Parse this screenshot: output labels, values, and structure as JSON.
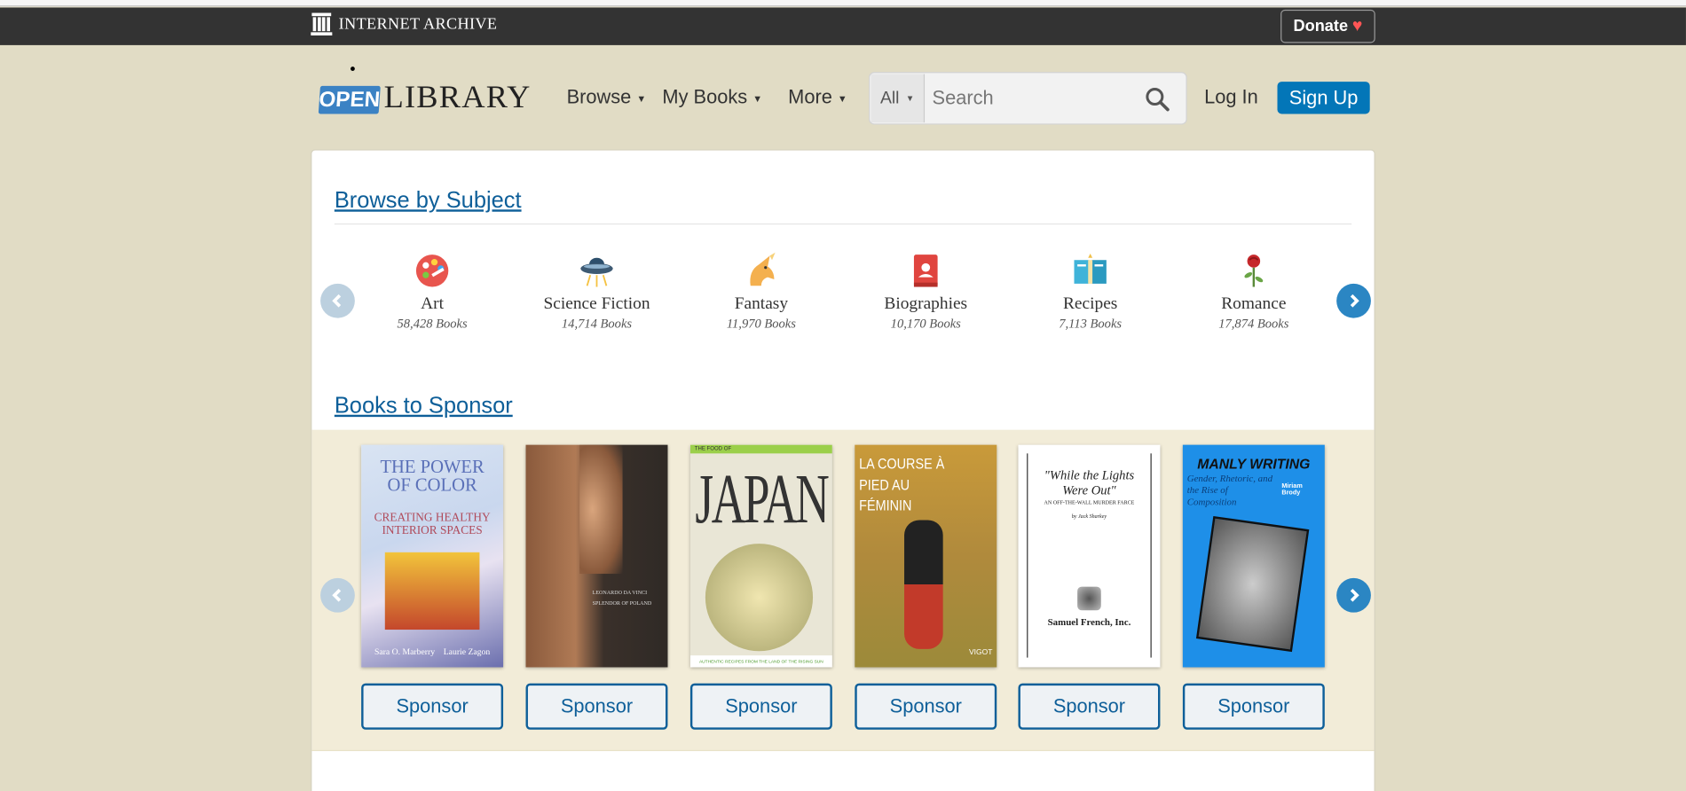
{
  "topbar": {
    "archive_name": "INTERNET ARCHIVE",
    "donate_label": "Donate",
    "donate_heart": "♥"
  },
  "header": {
    "logo_open": "OPEN",
    "logo_library": "LIBRARY",
    "nav": {
      "browse": "Browse",
      "my_books": "My Books",
      "more": "More"
    },
    "search": {
      "scope": "All",
      "placeholder": "Search"
    },
    "login": "Log In",
    "signup": "Sign Up"
  },
  "browse_subject": {
    "title": "Browse by Subject",
    "subjects": [
      {
        "name": "Art",
        "count": "58,428 Books",
        "icon": "palette-icon"
      },
      {
        "name": "Science Fiction",
        "count": "14,714 Books",
        "icon": "ufo-icon"
      },
      {
        "name": "Fantasy",
        "count": "11,970 Books",
        "icon": "unicorn-icon"
      },
      {
        "name": "Biographies",
        "count": "10,170 Books",
        "icon": "book-icon"
      },
      {
        "name": "Recipes",
        "count": "7,113 Books",
        "icon": "recipe-book-icon"
      },
      {
        "name": "Romance",
        "count": "17,874 Books",
        "icon": "rose-icon"
      }
    ]
  },
  "books_to_sponsor": {
    "title": "Books to Sponsor",
    "button_label": "Sponsor",
    "books": [
      {
        "cover_title": "THE POWER OF COLOR",
        "cover_sub": "CREATING HEALTHY INTERIOR SPACES",
        "cover_authors": "Sara O. Marberry    Laurie Zagon"
      },
      {
        "cover_title": "LEONARDO DA VINCI",
        "cover_sub": "SPLENDOR OF POLAND"
      },
      {
        "cover_title": "JAPAN",
        "cover_sub": "THE FOOD OF",
        "cover_foot": "AUTHENTIC RECIPES FROM THE LAND OF THE RISING SUN"
      },
      {
        "cover_title": "LA COURSE À PIED AU FÉMININ",
        "cover_foot": "VIGOT"
      },
      {
        "cover_title": "\"While the Lights Were Out\"",
        "cover_sub": "AN OFF-THE-WALL MURDER FARCE",
        "cover_author": "by Jack Sharkey",
        "cover_pub": "Samuel French, Inc."
      },
      {
        "cover_title": "MANLY WRITING",
        "cover_sub": "Gender, Rhetoric, and the Rise of Composition",
        "cover_author": "Miriam Brody"
      }
    ]
  },
  "colors": {
    "page_bg": "#e1dcc5",
    "link": "#0e5f99",
    "signup": "#0376b8",
    "topbar": "#333333"
  }
}
